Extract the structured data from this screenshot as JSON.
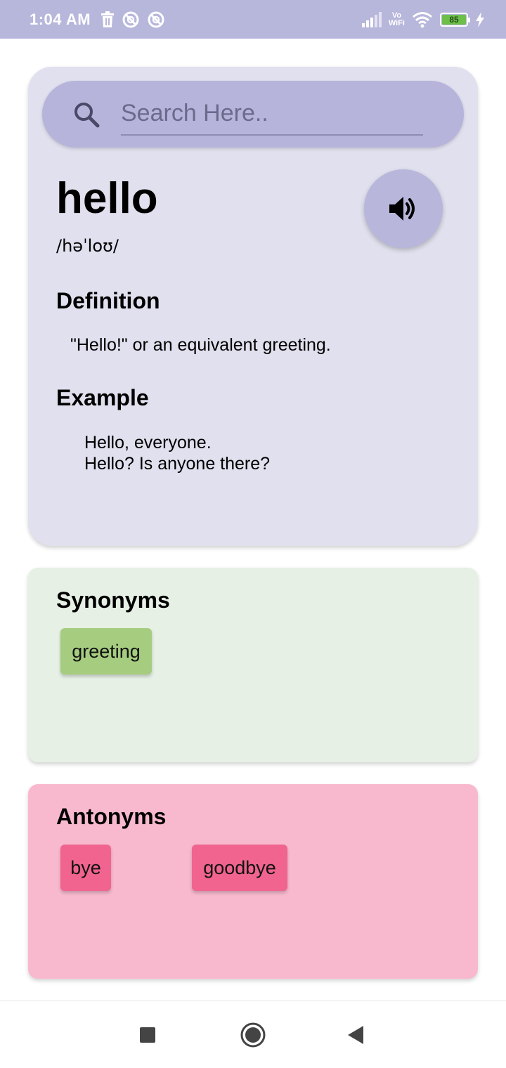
{
  "status_bar": {
    "time": "1:04 AM",
    "left_icons": [
      "trash-icon",
      "blocked-circle-icon",
      "blocked-circle-icon"
    ],
    "volte_top": "Vo",
    "volte_bottom": "WiFi",
    "battery_level": "85",
    "colors": {
      "background": "#b7b6db",
      "battery_fill": "#6cc04a"
    }
  },
  "search": {
    "placeholder": "Search Here..",
    "value": ""
  },
  "word": {
    "title": "hello",
    "phonetic": "/həˈloʊ/",
    "speaker_icon": "speaker-volume-icon"
  },
  "definition": {
    "heading": "Definition",
    "text": "\"Hello!\" or an equivalent greeting."
  },
  "example": {
    "heading": "Example",
    "lines": [
      "Hello, everyone.",
      "Hello? Is anyone there?"
    ]
  },
  "synonyms": {
    "heading": "Synonyms",
    "items": [
      "greeting"
    ],
    "colors": {
      "card": "#e6f0e5",
      "chip": "#a6cc80"
    }
  },
  "antonyms": {
    "heading": "Antonyms",
    "items": [
      "bye",
      "goodbye"
    ],
    "colors": {
      "card": "#f8b9cf",
      "chip": "#f0648f"
    }
  },
  "nav_bar": {
    "buttons": [
      "recents-square-icon",
      "home-circle-icon",
      "back-triangle-icon"
    ]
  },
  "theme": {
    "word_card": "#e0e0ee",
    "accent": "#b6b4da"
  }
}
